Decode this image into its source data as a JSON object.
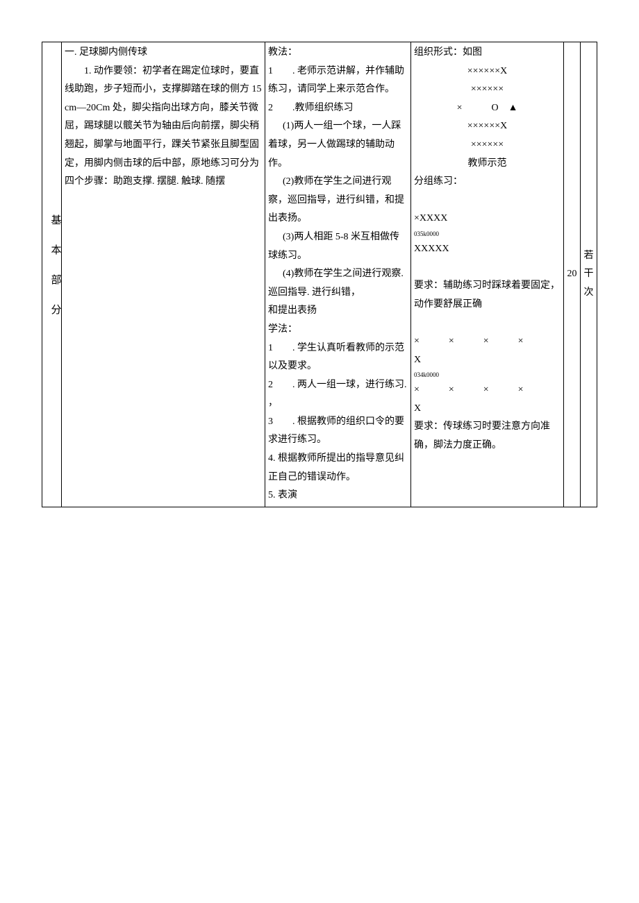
{
  "row_label": "基本部分",
  "content": {
    "title": "一. 足球脚内侧传球",
    "point_label": "1. 动作要领：",
    "point_text": "初学者在踢定位球时，要直线助跑，步子短而小，支撑脚踏在球的侧方 15cm—20Cm 处，脚尖指向出球方向，膝关节微屈，踢球腿以髋关节为轴由后向前摆，脚尖稍翘起，脚掌与地面平行，踝关节紧张且脚型固定，用脚内侧击球的后中部，原地练习可分为四个步骤：助跑支撑. 摆腿. 触球. 随摆"
  },
  "teaching": {
    "header": "教法：",
    "t1": "1　　. 老师示范讲解，并作辅助练习，请同学上来示范合作。",
    "t2": "2　　.教师组织练习",
    "t2_1": "(1)两人一组一个球，一人踩着球，另一人做踢球的辅助动作。",
    "t2_2": "(2)教师在学生之间进行观察，巡回指导，进行纠错，和提出表扬。",
    "t2_3": "(3)两人相距 5-8 米互相做传球练习。",
    "t2_4": "(4)教师在学生之间进行观察. 巡回指导. 进行纠错，",
    "t2_5": "和提出表扬",
    "study_header": "学法：",
    "s1": "1　　. 学生认真听看教师的示范以及要求。",
    "s2": "2　　. 两人一组一球，进行练习. ，",
    "s3": "3　　. 根据教师的组织口令的要求进行练习。",
    "s4": "4. 根据教师所提出的指导意见纠正自己的错误动作。",
    "s5": "5. 表演"
  },
  "org": {
    "header": "组织形式：如图",
    "row1": "××××××X",
    "row2": "××××××",
    "row3": "×　　　O　▲",
    "row4": "××××××X",
    "row5": "××××××",
    "demo_label": "教师示范",
    "group_label": "分组练习：",
    "g1": "×XXXX",
    "tiny1": "035k0000",
    "g2": "XXXXX",
    "req1": "要求：辅助练习时踩球着要固定，动作要舒展正确",
    "line1": "×　×　×　×　X",
    "tiny2": "034k0000",
    "line2": "×　×　×　×　X",
    "req2": "要求：传球练习时要注意方向准确，脚法力度正确。"
  },
  "time": "20",
  "reps": "若干次"
}
